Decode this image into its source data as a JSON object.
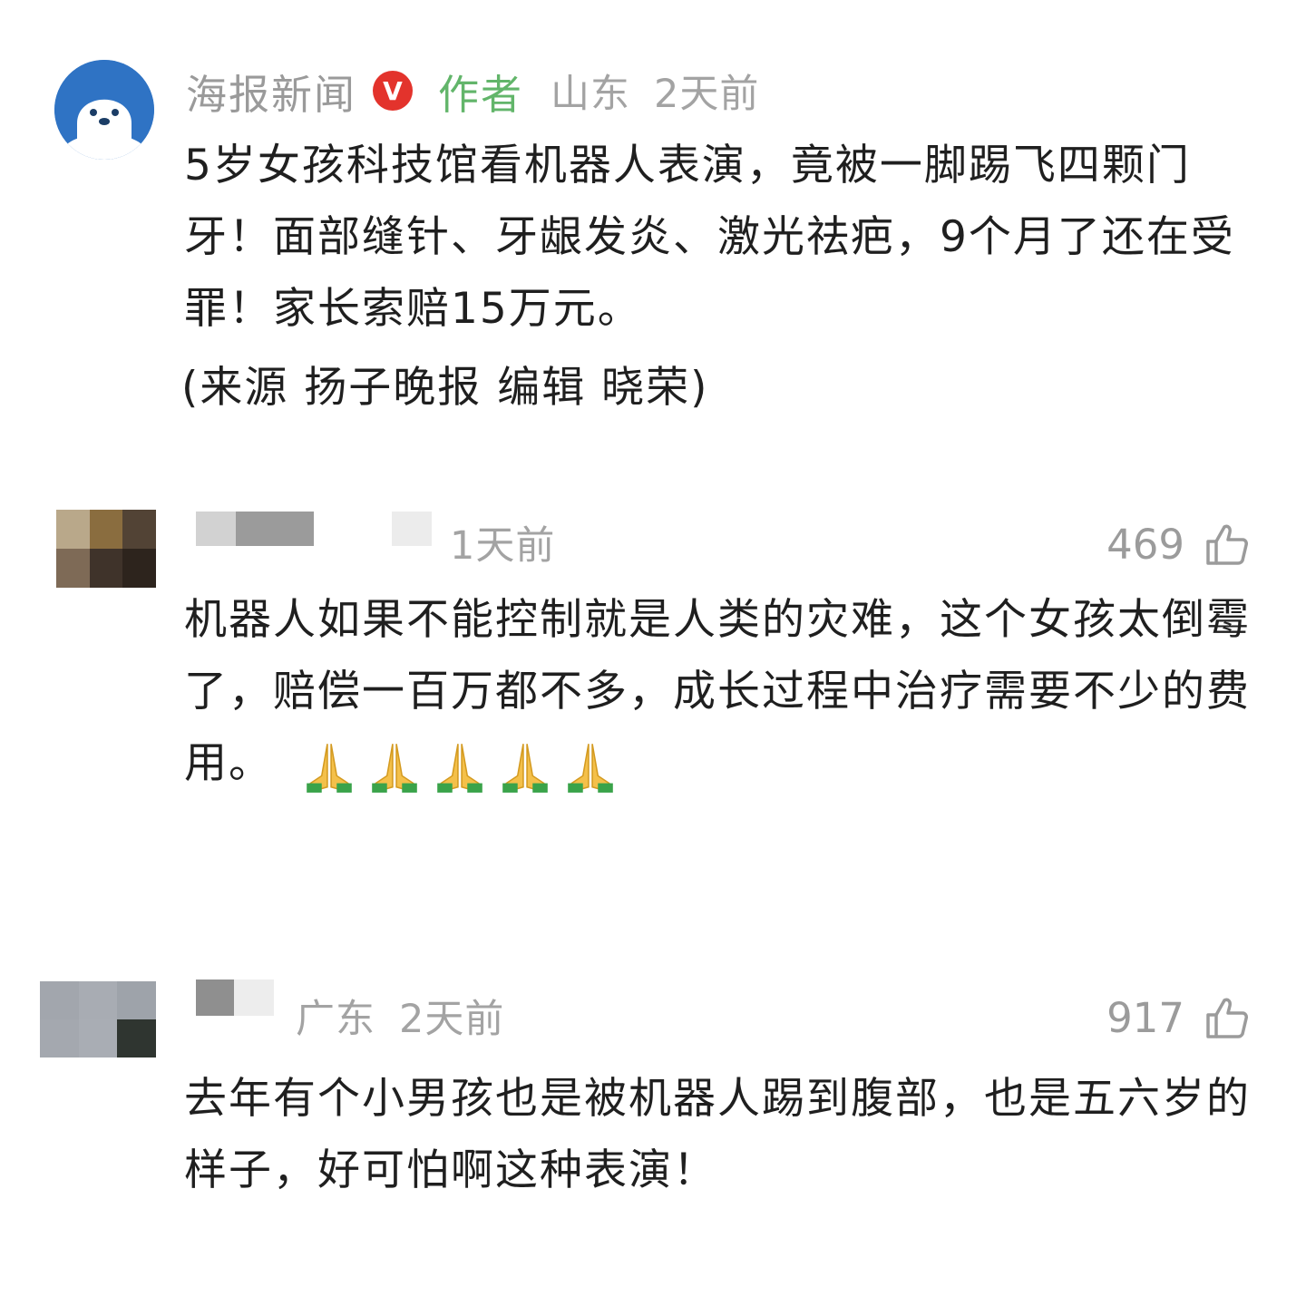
{
  "post": {
    "author_name": "海报新闻",
    "verified_badge": "V",
    "author_tag": "作者",
    "location": "山东",
    "time": "2天前",
    "text": "5岁女孩科技馆看机器人表演，竟被一脚踢飞四颗门牙！面部缝针、牙龈发炎、激光祛疤，9个月了还在受罪！家长索赔15万元。",
    "source": "(来源 扬子晚报 编辑 晓荣)"
  },
  "comments": [
    {
      "time": "1天前",
      "likes": "469",
      "text": "机器人如果不能控制就是人类的灾难，这个女孩太倒霉了，赔偿一百万都不多，成长过程中治疗需要不少的费用。",
      "emoji_count": 5
    },
    {
      "location": "广东",
      "time": "2天前",
      "likes": "917",
      "text": "去年有个小男孩也是被机器人踢到腹部，也是五六岁的样子，好可怕啊这种表演！"
    }
  ],
  "colors": {
    "author_green": "#62b56a",
    "badge_red": "#e3332c",
    "meta_gray": "#a3a3a3",
    "avatar_blue": "#2f73c4"
  },
  "icons": {
    "like": "thumbs-up-icon",
    "verified": "verified-badge-icon",
    "emoji": "folded-hands-emoji"
  }
}
